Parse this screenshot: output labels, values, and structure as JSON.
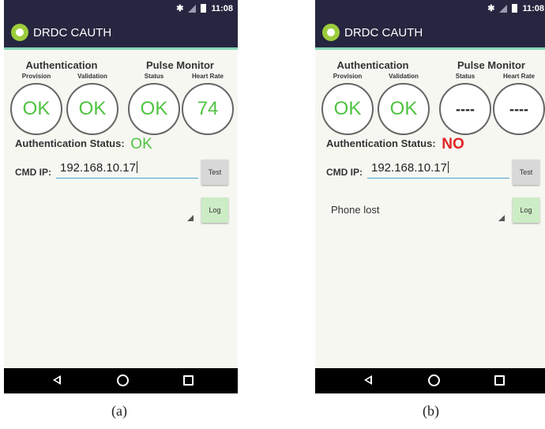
{
  "figure": {
    "captions": [
      "(a)",
      "(b)"
    ]
  },
  "screens": [
    {
      "status_bar": {
        "time": "11:08",
        "icons": [
          "bluetooth-icon",
          "signal-icon",
          "battery-icon"
        ]
      },
      "app_bar": {
        "title": "DRDC CAUTH",
        "logo_icon": "android-app-icon"
      },
      "authentication": {
        "heading": "Authentication",
        "provision_label": "Provision",
        "provision_value": "OK",
        "validation_label": "Validation",
        "validation_value": "OK"
      },
      "pulse_monitor": {
        "heading": "Pulse Monitor",
        "status_label": "Status",
        "status_value": "OK",
        "heart_rate_label": "Heart Rate",
        "heart_rate_value": "74"
      },
      "auth_status": {
        "label": "Authentication Status:",
        "value": "OK",
        "color": "#4fc340"
      },
      "cmd_ip": {
        "label": "CMD IP:",
        "value": "192.168.10.17"
      },
      "buttons": {
        "test": "Test",
        "log": "Log"
      },
      "log_text": "",
      "nav_bar": [
        "back-icon",
        "home-icon",
        "recents-icon"
      ]
    },
    {
      "status_bar": {
        "time": "11:08",
        "icons": [
          "bluetooth-icon",
          "signal-icon",
          "battery-icon"
        ]
      },
      "app_bar": {
        "title": "DRDC CAUTH",
        "logo_icon": "android-app-icon"
      },
      "authentication": {
        "heading": "Authentication",
        "provision_label": "Provision",
        "provision_value": "OK",
        "validation_label": "Validation",
        "validation_value": "OK"
      },
      "pulse_monitor": {
        "heading": "Pulse Monitor",
        "status_label": "Status",
        "status_value": "----",
        "heart_rate_label": "Heart Rate",
        "heart_rate_value": "----"
      },
      "auth_status": {
        "label": "Authentication Status:",
        "value": "NO",
        "color": "#e02424"
      },
      "cmd_ip": {
        "label": "CMD IP:",
        "value": "192.168.10.17"
      },
      "buttons": {
        "test": "Test",
        "log": "Log"
      },
      "log_text": "Phone lost",
      "nav_bar": [
        "back-icon",
        "home-icon",
        "recents-icon"
      ]
    }
  ]
}
